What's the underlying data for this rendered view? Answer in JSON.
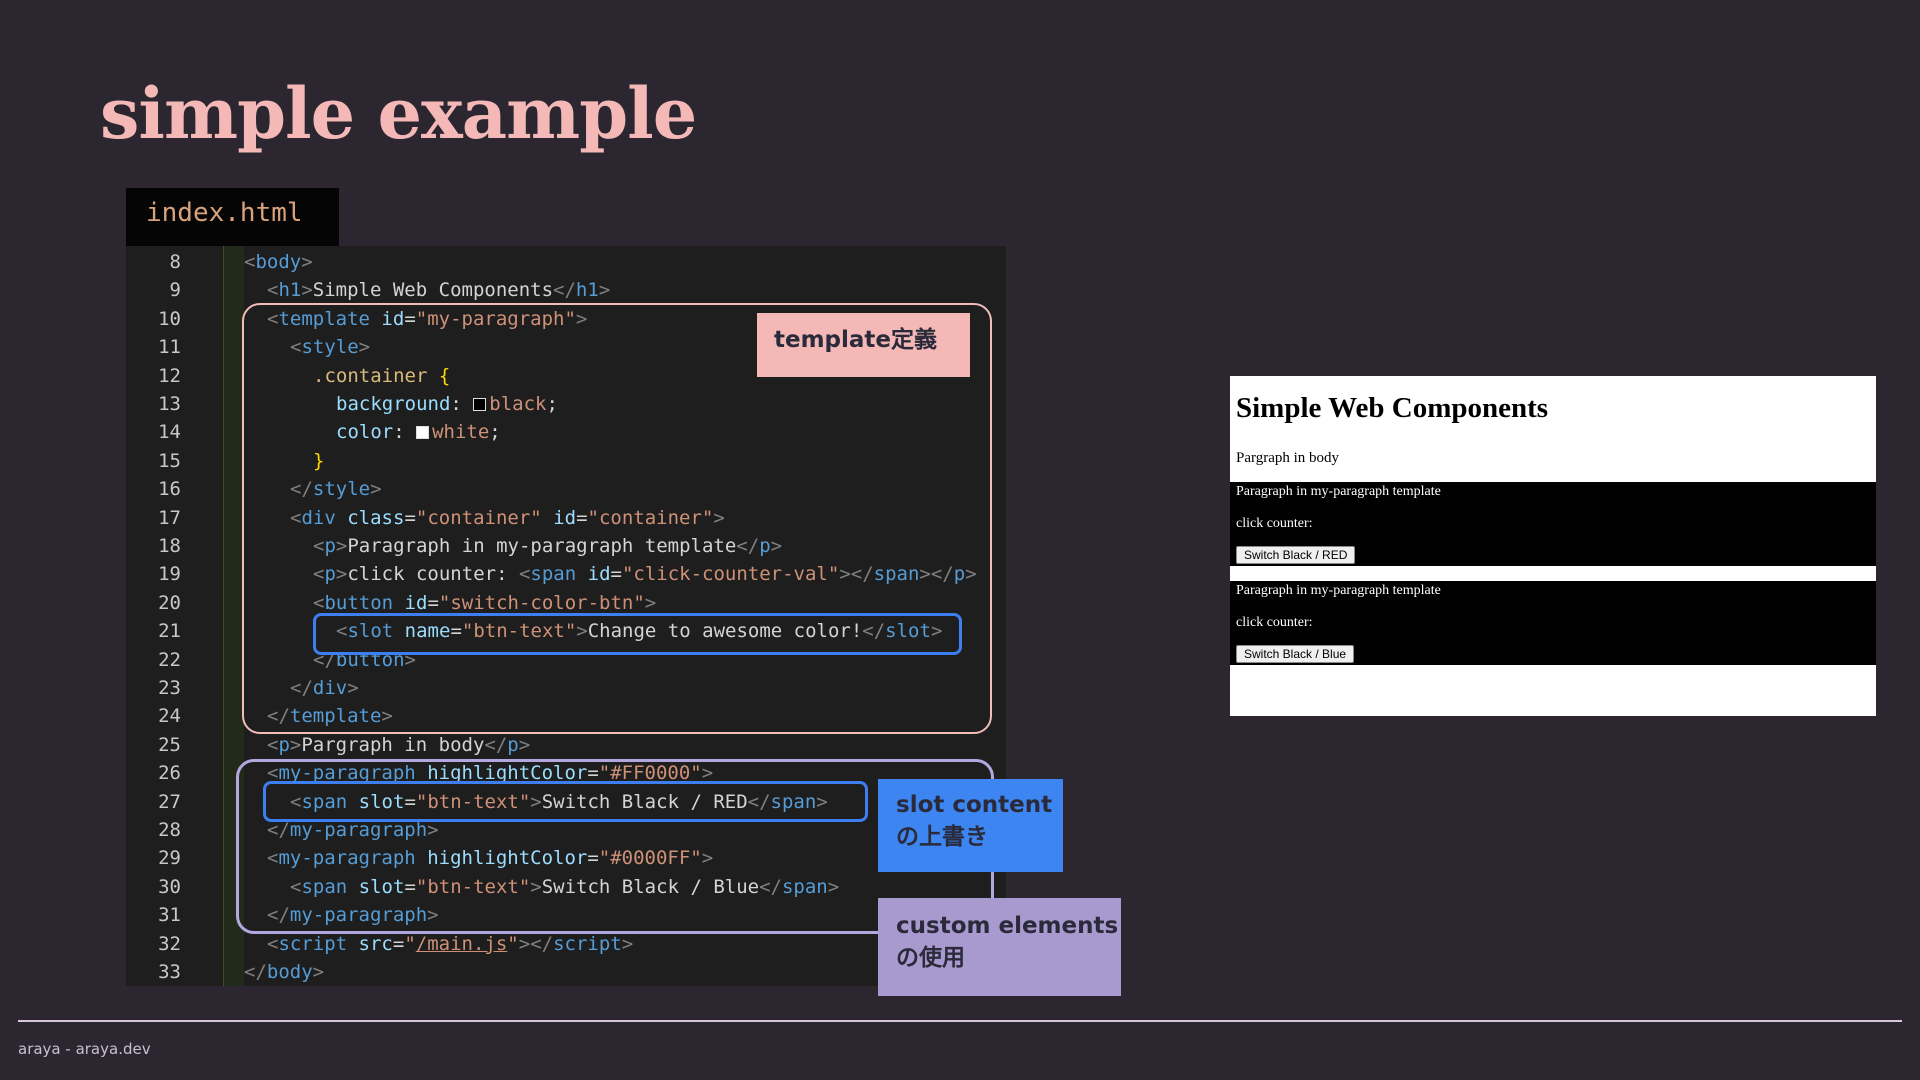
{
  "slide": {
    "title": "simple example",
    "footer": "araya - araya.dev"
  },
  "editor": {
    "file_tab": "index.html",
    "colors": {
      "background": "#1e1e1e",
      "tag": "#569cd6",
      "attribute": "#9cdcfe",
      "string": "#ce9178"
    },
    "lines": [
      {
        "n": "8",
        "indent": 0,
        "tokens": [
          [
            "p",
            "<"
          ],
          [
            "t",
            "body"
          ],
          [
            "p",
            ">"
          ]
        ]
      },
      {
        "n": "9",
        "indent": 1,
        "tokens": [
          [
            "p",
            "<"
          ],
          [
            "t",
            "h1"
          ],
          [
            "p",
            ">"
          ],
          [
            "x",
            "Simple Web Components"
          ],
          [
            "p",
            "</"
          ],
          [
            "t",
            "h1"
          ],
          [
            "p",
            ">"
          ]
        ]
      },
      {
        "n": "10",
        "indent": 1,
        "tokens": [
          [
            "p",
            "<"
          ],
          [
            "t",
            "template"
          ],
          [
            "x",
            " "
          ],
          [
            "a",
            "id"
          ],
          [
            "x",
            "="
          ],
          [
            "s",
            "\"my-paragraph\""
          ],
          [
            "p",
            ">"
          ]
        ]
      },
      {
        "n": "11",
        "indent": 2,
        "tokens": [
          [
            "p",
            "<"
          ],
          [
            "t",
            "style"
          ],
          [
            "p",
            ">"
          ]
        ]
      },
      {
        "n": "12",
        "indent": 3,
        "tokens": [
          [
            "c",
            ".container"
          ],
          [
            "x",
            " "
          ],
          [
            "b",
            "{"
          ]
        ]
      },
      {
        "n": "13",
        "indent": 4,
        "tokens": [
          [
            "a",
            "background"
          ],
          [
            "x",
            ": "
          ],
          [
            "sw",
            "black"
          ],
          [
            "s",
            "black"
          ],
          [
            "x",
            ";"
          ]
        ]
      },
      {
        "n": "14",
        "indent": 4,
        "tokens": [
          [
            "a",
            "color"
          ],
          [
            "x",
            ": "
          ],
          [
            "sw",
            "white"
          ],
          [
            "s",
            "white"
          ],
          [
            "x",
            ";"
          ]
        ]
      },
      {
        "n": "15",
        "indent": 3,
        "tokens": [
          [
            "b",
            "}"
          ]
        ]
      },
      {
        "n": "16",
        "indent": 2,
        "tokens": [
          [
            "p",
            "</"
          ],
          [
            "t",
            "style"
          ],
          [
            "p",
            ">"
          ]
        ]
      },
      {
        "n": "17",
        "indent": 2,
        "tokens": [
          [
            "p",
            "<"
          ],
          [
            "t",
            "div"
          ],
          [
            "x",
            " "
          ],
          [
            "a",
            "class"
          ],
          [
            "x",
            "="
          ],
          [
            "s",
            "\"container\""
          ],
          [
            "x",
            " "
          ],
          [
            "a",
            "id"
          ],
          [
            "x",
            "="
          ],
          [
            "s",
            "\"container\""
          ],
          [
            "p",
            ">"
          ]
        ]
      },
      {
        "n": "18",
        "indent": 3,
        "tokens": [
          [
            "p",
            "<"
          ],
          [
            "t",
            "p"
          ],
          [
            "p",
            ">"
          ],
          [
            "x",
            "Paragraph in my-paragraph template"
          ],
          [
            "p",
            "</"
          ],
          [
            "t",
            "p"
          ],
          [
            "p",
            ">"
          ]
        ]
      },
      {
        "n": "19",
        "indent": 3,
        "tokens": [
          [
            "p",
            "<"
          ],
          [
            "t",
            "p"
          ],
          [
            "p",
            ">"
          ],
          [
            "x",
            "click counter: "
          ],
          [
            "p",
            "<"
          ],
          [
            "t",
            "span"
          ],
          [
            "x",
            " "
          ],
          [
            "a",
            "id"
          ],
          [
            "x",
            "="
          ],
          [
            "s",
            "\"click-counter-val\""
          ],
          [
            "p",
            "></"
          ],
          [
            "t",
            "span"
          ],
          [
            "p",
            "></"
          ],
          [
            "t",
            "p"
          ],
          [
            "p",
            ">"
          ]
        ]
      },
      {
        "n": "20",
        "indent": 3,
        "tokens": [
          [
            "p",
            "<"
          ],
          [
            "t",
            "button"
          ],
          [
            "x",
            " "
          ],
          [
            "a",
            "id"
          ],
          [
            "x",
            "="
          ],
          [
            "s",
            "\"switch-color-btn\""
          ],
          [
            "p",
            ">"
          ]
        ]
      },
      {
        "n": "21",
        "indent": 4,
        "tokens": [
          [
            "p",
            "<"
          ],
          [
            "t",
            "slot"
          ],
          [
            "x",
            " "
          ],
          [
            "a",
            "name"
          ],
          [
            "x",
            "="
          ],
          [
            "s",
            "\"btn-text\""
          ],
          [
            "p",
            ">"
          ],
          [
            "x",
            "Change to awesome color!"
          ],
          [
            "p",
            "</"
          ],
          [
            "t",
            "slot"
          ],
          [
            "p",
            ">"
          ]
        ]
      },
      {
        "n": "22",
        "indent": 3,
        "tokens": [
          [
            "p",
            "</"
          ],
          [
            "t",
            "button"
          ],
          [
            "p",
            ">"
          ]
        ]
      },
      {
        "n": "23",
        "indent": 2,
        "tokens": [
          [
            "p",
            "</"
          ],
          [
            "t",
            "div"
          ],
          [
            "p",
            ">"
          ]
        ]
      },
      {
        "n": "24",
        "indent": 1,
        "tokens": [
          [
            "p",
            "</"
          ],
          [
            "t",
            "template"
          ],
          [
            "p",
            ">"
          ]
        ]
      },
      {
        "n": "25",
        "indent": 1,
        "tokens": [
          [
            "p",
            "<"
          ],
          [
            "t",
            "p"
          ],
          [
            "p",
            ">"
          ],
          [
            "x",
            "Pargraph in body"
          ],
          [
            "p",
            "</"
          ],
          [
            "t",
            "p"
          ],
          [
            "p",
            ">"
          ]
        ]
      },
      {
        "n": "26",
        "indent": 1,
        "tokens": [
          [
            "p",
            "<"
          ],
          [
            "t",
            "my-paragraph"
          ],
          [
            "x",
            " "
          ],
          [
            "a",
            "highlightColor"
          ],
          [
            "x",
            "="
          ],
          [
            "s",
            "\"#FF0000\""
          ],
          [
            "p",
            ">"
          ]
        ]
      },
      {
        "n": "27",
        "indent": 2,
        "tokens": [
          [
            "p",
            "<"
          ],
          [
            "t",
            "span"
          ],
          [
            "x",
            " "
          ],
          [
            "a",
            "slot"
          ],
          [
            "x",
            "="
          ],
          [
            "s",
            "\"btn-text\""
          ],
          [
            "p",
            ">"
          ],
          [
            "x",
            "Switch Black / RED"
          ],
          [
            "p",
            "</"
          ],
          [
            "t",
            "span"
          ],
          [
            "p",
            ">"
          ]
        ]
      },
      {
        "n": "28",
        "indent": 1,
        "tokens": [
          [
            "p",
            "</"
          ],
          [
            "t",
            "my-paragraph"
          ],
          [
            "p",
            ">"
          ]
        ]
      },
      {
        "n": "29",
        "indent": 1,
        "tokens": [
          [
            "p",
            "<"
          ],
          [
            "t",
            "my-paragraph"
          ],
          [
            "x",
            " "
          ],
          [
            "a",
            "highlightColor"
          ],
          [
            "x",
            "="
          ],
          [
            "s",
            "\"#0000FF\""
          ],
          [
            "p",
            ">"
          ]
        ]
      },
      {
        "n": "30",
        "indent": 2,
        "tokens": [
          [
            "p",
            "<"
          ],
          [
            "t",
            "span"
          ],
          [
            "x",
            " "
          ],
          [
            "a",
            "slot"
          ],
          [
            "x",
            "="
          ],
          [
            "s",
            "\"btn-text\""
          ],
          [
            "p",
            ">"
          ],
          [
            "x",
            "Switch Black / Blue"
          ],
          [
            "p",
            "</"
          ],
          [
            "t",
            "span"
          ],
          [
            "p",
            ">"
          ]
        ]
      },
      {
        "n": "31",
        "indent": 1,
        "tokens": [
          [
            "p",
            "</"
          ],
          [
            "t",
            "my-paragraph"
          ],
          [
            "p",
            ">"
          ]
        ]
      },
      {
        "n": "32",
        "indent": 1,
        "tokens": [
          [
            "p",
            "<"
          ],
          [
            "t",
            "script"
          ],
          [
            "x",
            " "
          ],
          [
            "a",
            "src"
          ],
          [
            "x",
            "="
          ],
          [
            "s",
            "\""
          ],
          [
            "su",
            "/main.js"
          ],
          [
            "s",
            "\""
          ],
          [
            "p",
            "></"
          ],
          [
            "t",
            "script"
          ],
          [
            "p",
            ">"
          ]
        ]
      },
      {
        "n": "33",
        "indent": 0,
        "tokens": [
          [
            "p",
            "</"
          ],
          [
            "t",
            "body"
          ],
          [
            "p",
            ">"
          ]
        ]
      }
    ]
  },
  "annotations": {
    "template_label": "template定義",
    "slot_label": "slot content\nの上書き",
    "custom_label": "custom elements\nの使用",
    "colors": {
      "template": "#f4b9b7",
      "slot": "#3d85f0",
      "custom": "#a89ace"
    }
  },
  "preview": {
    "heading": "Simple Web Components",
    "body_paragraph": "Pargraph in body",
    "blocks": [
      {
        "paragraph": "Paragraph in my-paragraph template",
        "counter": "click counter:",
        "button": "Switch Black / RED"
      },
      {
        "paragraph": "Paragraph in my-paragraph template",
        "counter": "click counter:",
        "button": "Switch Black / Blue"
      }
    ]
  }
}
